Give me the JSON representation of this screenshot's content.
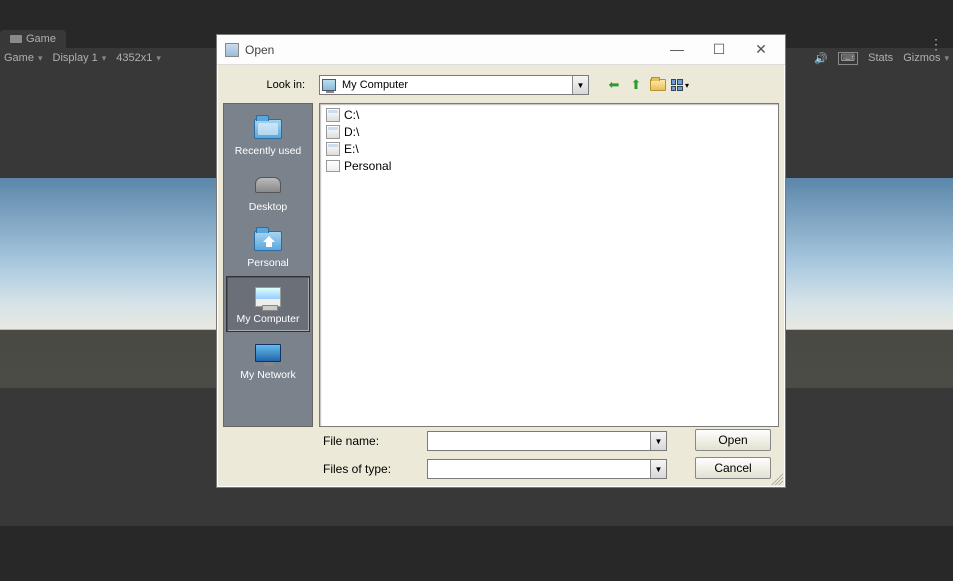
{
  "unity": {
    "tab_label": "Game",
    "toolbar": {
      "game_dropdown": "Game",
      "display_dropdown": "Display 1",
      "resolution_dropdown": "4352x1",
      "stats_label": "Stats",
      "gizmos_label": "Gizmos"
    }
  },
  "dialog": {
    "title": "Open",
    "lookin_label": "Look in:",
    "lookin_value": "My Computer",
    "places": [
      {
        "label": "Recently used",
        "kind": "folder",
        "selected": false
      },
      {
        "label": "Desktop",
        "kind": "desktop",
        "selected": false
      },
      {
        "label": "Personal",
        "kind": "home",
        "selected": false
      },
      {
        "label": "My Computer",
        "kind": "computer",
        "selected": true
      },
      {
        "label": "My Network",
        "kind": "network",
        "selected": false
      }
    ],
    "files": [
      {
        "label": "C:\\",
        "kind": "drive"
      },
      {
        "label": "D:\\",
        "kind": "drive"
      },
      {
        "label": "E:\\",
        "kind": "drive"
      },
      {
        "label": "Personal",
        "kind": "folder"
      }
    ],
    "filename_label": "File name:",
    "filename_value": "",
    "filetype_label": "Files of type:",
    "filetype_value": "",
    "open_button": "Open",
    "cancel_button": "Cancel"
  }
}
